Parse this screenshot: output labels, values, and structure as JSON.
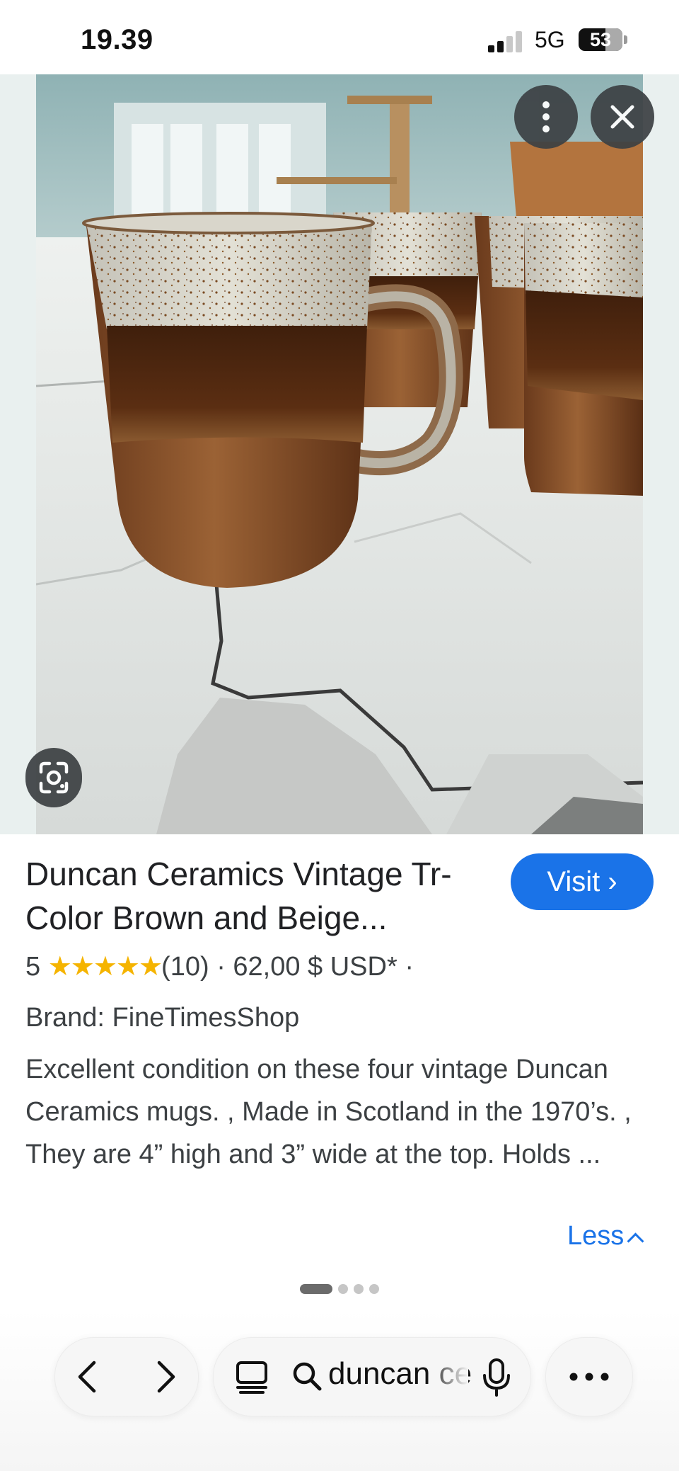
{
  "status_bar": {
    "time": "19.39",
    "network": "5G",
    "battery": "53"
  },
  "image_controls": {
    "more_icon": "more-vert-icon",
    "close_icon": "close-icon",
    "lens_icon": "lens-icon"
  },
  "product": {
    "title": "Duncan Ceramics Vintage Tr-Color Brown and Beige...",
    "visit_label": "Visit ›",
    "rating_value": "5",
    "stars": "★★★★★",
    "reviews": "(10)",
    "price": "· 62,00 $ USD* ·",
    "brand": "Brand: FineTimesShop",
    "description": "Excellent condition on these four vintage Duncan Ceramics mugs. , Made in Scotland in the 1970’s. , They are 4” high and 3” wide at the top. Holds ...",
    "less_label": "Less"
  },
  "pagination": {
    "count": 4,
    "active": 0
  },
  "toolbar": {
    "search_text": "duncan ce",
    "icons": [
      "back-icon",
      "forward-icon",
      "tabs-icon",
      "search-icon",
      "mic-icon",
      "more-horiz-icon"
    ]
  },
  "colors": {
    "accent": "#1a73e8",
    "star": "#f5b400",
    "overlay_button": "#3c4043"
  }
}
